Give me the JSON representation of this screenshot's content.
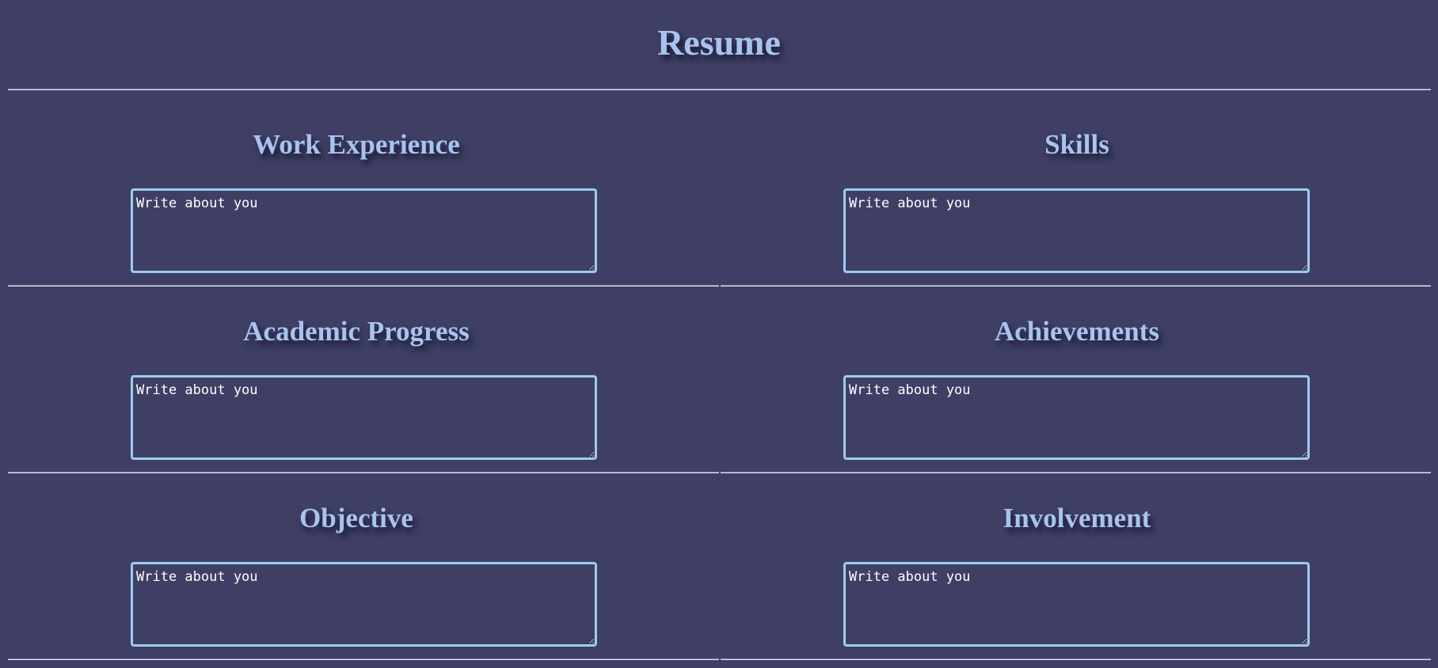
{
  "page": {
    "title": "Resume"
  },
  "sections": [
    {
      "heading": "Work Experience",
      "placeholder": "Write about you"
    },
    {
      "heading": "Skills",
      "placeholder": "Write about you"
    },
    {
      "heading": "Academic Progress",
      "placeholder": "Write about you"
    },
    {
      "heading": "Achievements",
      "placeholder": "Write about you"
    },
    {
      "heading": "Objective",
      "placeholder": "Write about you"
    },
    {
      "heading": "Involvement",
      "placeholder": "Write about you"
    }
  ],
  "colors": {
    "background": "#3f3f66",
    "heading": "#a9c3f0",
    "field_border": "#9ecbf0",
    "field_text": "#ffffff"
  }
}
